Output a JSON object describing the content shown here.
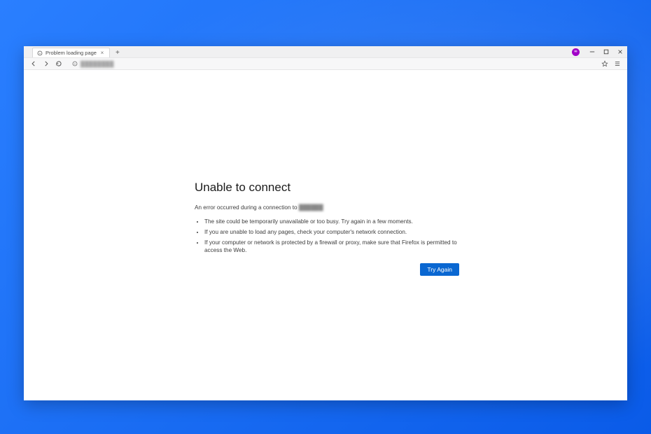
{
  "window": {
    "account_initials": "∞",
    "controls": {
      "minimize": "minimize",
      "maximize": "maximize",
      "close": "close"
    }
  },
  "tab": {
    "title": "Problem loading page",
    "favicon": "info-icon"
  },
  "navbar": {
    "back": "back",
    "forward": "forward",
    "reload": "reload",
    "identity": "info-icon",
    "url_display": "████████",
    "bookmark": "star-icon",
    "menu": "menu-icon"
  },
  "error": {
    "title": "Unable to connect",
    "message_prefix": "An error occurred during a connection to ",
    "host_display": "██████",
    "bullets": [
      "The site could be temporarily unavailable or too busy. Try again in a few moments.",
      "If you are unable to load any pages, check your computer's network connection.",
      "If your computer or network is protected by a firewall or proxy, make sure that Firefox is permitted to access the Web."
    ],
    "try_again_label": "Try Again"
  }
}
